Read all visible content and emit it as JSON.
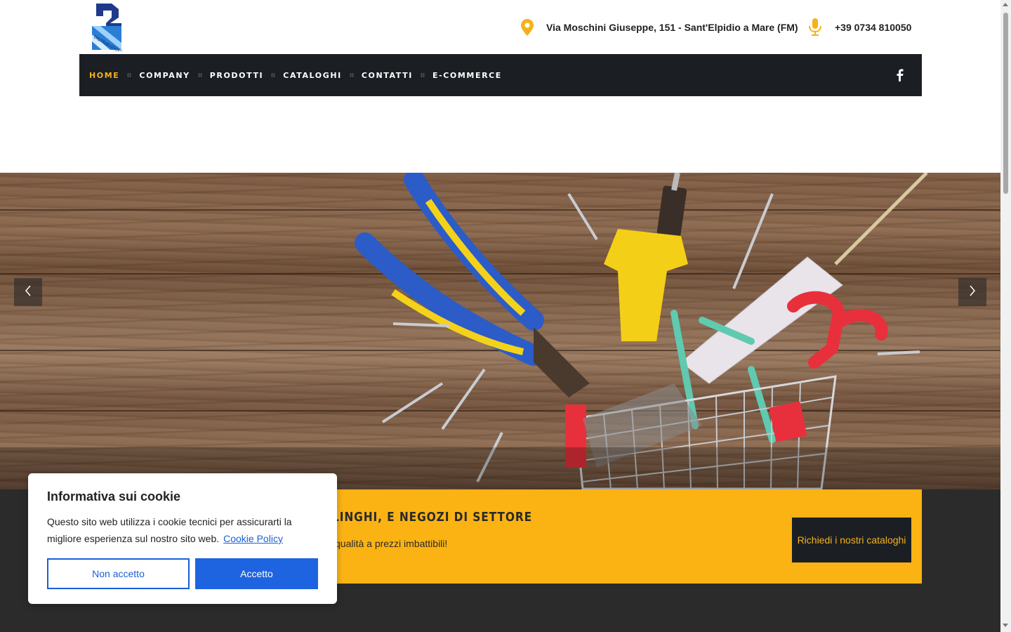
{
  "header": {
    "logo_name": "logo",
    "address": "Via Moschini Giuseppe, 151 - Sant'Elpidio a Mare (FM)",
    "phone": "+39 0734 810050",
    "accent_color": "#f6b21a"
  },
  "nav": {
    "items": [
      {
        "label": "HOME",
        "active": true
      },
      {
        "label": "COMPANY",
        "active": false
      },
      {
        "label": "PRODOTTI",
        "active": false
      },
      {
        "label": "CATALOGHI",
        "active": false
      },
      {
        "label": "CONTATTI",
        "active": false
      },
      {
        "label": "E-COMMERCE",
        "active": false
      }
    ],
    "social_icon": "facebook-icon",
    "background": "#1b1f24"
  },
  "hero": {
    "prev_icon": "chevron-left-icon",
    "next_icon": "chevron-right-icon"
  },
  "promo": {
    "title": "LINGHI, E NEGOZI DI SETTORE",
    "subtitle": "qualità a prezzi imbattibili!",
    "button_label": "Richiedi i nostri cataloghi",
    "background": "#fbb314"
  },
  "cookie": {
    "title": "Informativa sui cookie",
    "text": "Questo sito web utilizza i cookie tecnici per assicurarti la migliore esperienza sul nostro sito web.",
    "link_label": "Cookie Policy",
    "reject_label": "Non accetto",
    "accept_label": "Accetto",
    "button_color": "#1e63e0"
  }
}
